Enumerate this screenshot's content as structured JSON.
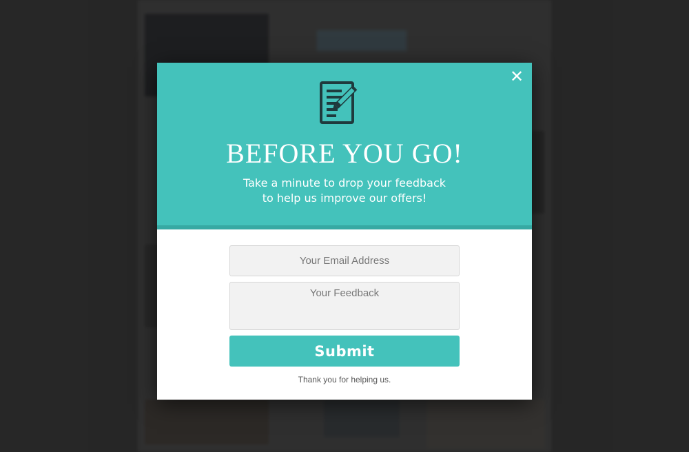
{
  "colors": {
    "accent": "#44c2bb",
    "accent_dark": "#37a9a3",
    "icon_dark": "#1f3a3d",
    "backdrop": "#2c2c2c"
  },
  "modal": {
    "close_icon": "close-icon",
    "close_label": "✕",
    "header_icon": "form-with-pencil-icon",
    "title": "BEFORE YOU GO!",
    "subtitle_line1": "Take a minute to drop your feedback",
    "subtitle_line2": "to help us improve our offers!",
    "email_placeholder": "Your Email Address",
    "email_value": "",
    "feedback_placeholder": "Your Feedback",
    "feedback_value": "",
    "submit_label": "Submit",
    "thanks_text": "Thank you for helping us."
  }
}
